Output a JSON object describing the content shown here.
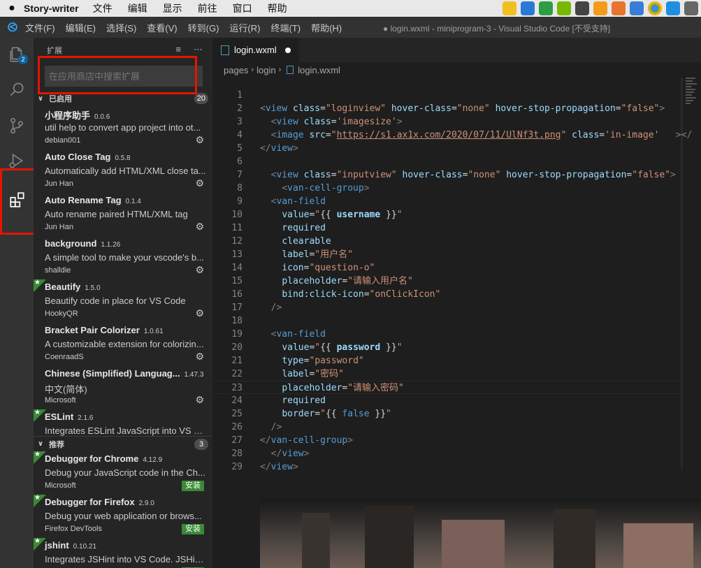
{
  "macbar": {
    "app_name": "Story-writer",
    "menus": [
      "文件",
      "编辑",
      "显示",
      "前往",
      "窗口",
      "帮助"
    ],
    "tray_icons": [
      "qq-icon",
      "notes-icon",
      "shield-icon",
      "nvidia-icon",
      "share-icon",
      "flame-icon",
      "calendar-icon",
      "security-icon",
      "chrome-icon",
      "ie-icon",
      "monitor-icon"
    ]
  },
  "titlebar": {
    "menus": [
      "文件(F)",
      "编辑(E)",
      "选择(S)",
      "查看(V)",
      "转到(G)",
      "运行(R)",
      "终端(T)",
      "帮助(H)"
    ],
    "window_title": "● login.wxml - miniprogram-3 - Visual Studio Code [不受支持]"
  },
  "activity": {
    "explorer_badge": "2",
    "items": [
      "explorer",
      "search",
      "source-control",
      "run-debug",
      "extensions"
    ],
    "active": "extensions"
  },
  "sidebar": {
    "title": "扩展",
    "search_placeholder": "在应用商店中搜索扩展",
    "installed_header": "已启用",
    "installed_count": "20",
    "installed": [
      {
        "name": "小程序助手",
        "version": "0.0.6",
        "desc": "util help to convert app project into ot...",
        "publisher": "debian001",
        "starred": false
      },
      {
        "name": "Auto Close Tag",
        "version": "0.5.8",
        "desc": "Automatically add HTML/XML close ta...",
        "publisher": "Jun Han",
        "starred": false
      },
      {
        "name": "Auto Rename Tag",
        "version": "0.1.4",
        "desc": "Auto rename paired HTML/XML tag",
        "publisher": "Jun Han",
        "starred": false
      },
      {
        "name": "background",
        "version": "1.1.26",
        "desc": "A simple tool to make your vscode's b...",
        "publisher": "shalldie",
        "starred": false
      },
      {
        "name": "Beautify",
        "version": "1.5.0",
        "desc": "Beautify code in place for VS Code",
        "publisher": "HookyQR",
        "starred": true
      },
      {
        "name": "Bracket Pair Colorizer",
        "version": "1.0.61",
        "desc": "A customizable extension for colorizin...",
        "publisher": "CoenraadS",
        "starred": false
      },
      {
        "name": "Chinese (Simplified) Languag...",
        "version": "1.47.3",
        "desc": "中文(简体)",
        "publisher": "Microsoft",
        "starred": false
      },
      {
        "name": "ESLint",
        "version": "2.1.6",
        "desc": "Integrates ESLint JavaScript into VS C...",
        "publisher": "",
        "starred": true
      }
    ],
    "recommended_header": "推荐",
    "recommended_count": "3",
    "install_label": "安装",
    "recommended": [
      {
        "name": "Debugger for Chrome",
        "version": "4.12.9",
        "desc": "Debug your JavaScript code in the Ch...",
        "publisher": "Microsoft",
        "starred": true
      },
      {
        "name": "Debugger for Firefox",
        "version": "2.9.0",
        "desc": "Debug your web application or brows...",
        "publisher": "Firefox DevTools",
        "starred": true
      },
      {
        "name": "jshint",
        "version": "0.10.21",
        "desc": "Integrates JSHint into VS Code. JSHint...",
        "publisher": "",
        "starred": true
      }
    ]
  },
  "editor": {
    "tab_label": "login.wxml",
    "breadcrumb": [
      "pages",
      "login",
      "login.wxml"
    ],
    "lines": [
      {
        "n": "1",
        "html": ""
      },
      {
        "n": "2",
        "html": "<span class='brk'>&lt;</span><span class='tag'>view</span> <span class='attr'>class</span>=<span class='str'>\"loginview\"</span> <span class='attr'>hover-class</span>=<span class='str'>\"none\"</span> <span class='attr'>hover-stop-propagation</span>=<span class='str'>\"false\"</span><span class='brk'>&gt;</span>"
      },
      {
        "n": "3",
        "html": "  <span class='brk'>&lt;</span><span class='tag'>view</span> <span class='attr'>class</span>=<span class='str'>'imagesize'</span><span class='brk'>&gt;</span>"
      },
      {
        "n": "4",
        "html": "  <span class='brk'>&lt;</span><span class='tag'>image</span> <span class='attr'>src</span>=<span class='str'>\"<u>https://s1.ax1x.com/2020/07/11/UlNf3t.png</u>\"</span> <span class='attr'>class</span>=<span class='str'>'in-image'</span>   <span class='brk'>&gt;&lt;/</span>"
      },
      {
        "n": "5",
        "html": "<span class='brk'>&lt;/</span><span class='tag'>view</span><span class='brk'>&gt;</span>"
      },
      {
        "n": "6",
        "html": ""
      },
      {
        "n": "7",
        "html": "  <span class='brk'>&lt;</span><span class='tag'>view</span> <span class='attr'>class</span>=<span class='str'>\"inputview\"</span> <span class='attr'>hover-class</span>=<span class='str'>\"none\"</span> <span class='attr'>hover-stop-propagation</span>=<span class='str'>\"false\"</span><span class='brk'>&gt;</span>"
      },
      {
        "n": "8",
        "html": "    <span class='brk'>&lt;</span><span class='tag'>van-cell-group</span><span class='brk'>&gt;</span>"
      },
      {
        "n": "9",
        "html": "  <span class='brk'>&lt;</span><span class='tag'>van-field</span>"
      },
      {
        "n": "10",
        "html": "    <span class='attr'>value</span>=<span class='str'>\"</span><span class='punc'>{{ </span><span class='attr' style='font-weight:bold'>username</span><span class='punc'> }}</span><span class='str'>\"</span>"
      },
      {
        "n": "11",
        "html": "    <span class='attr'>required</span>"
      },
      {
        "n": "12",
        "html": "    <span class='attr'>clearable</span>"
      },
      {
        "n": "13",
        "html": "    <span class='attr'>label</span>=<span class='str'>\"用户名\"</span>"
      },
      {
        "n": "14",
        "html": "    <span class='attr'>icon</span>=<span class='str'>\"question-o\"</span>"
      },
      {
        "n": "15",
        "html": "    <span class='attr'>placeholder</span>=<span class='str'>\"请输入用户名\"</span>"
      },
      {
        "n": "16",
        "html": "    <span class='attr'>bind:click-icon</span>=<span class='str'>\"onClickIcon\"</span>"
      },
      {
        "n": "17",
        "html": "  <span class='brk'>/&gt;</span>"
      },
      {
        "n": "18",
        "html": ""
      },
      {
        "n": "19",
        "html": "  <span class='brk'>&lt;</span><span class='tag'>van-field</span>"
      },
      {
        "n": "20",
        "html": "    <span class='attr'>value</span>=<span class='str'>\"</span><span class='punc'>{{ </span><span class='attr' style='font-weight:bold'>password</span><span class='punc'> }}</span><span class='str'>\"</span>"
      },
      {
        "n": "21",
        "html": "    <span class='attr'>type</span>=<span class='str'>\"password\"</span>"
      },
      {
        "n": "22",
        "html": "    <span class='attr'>label</span>=<span class='str'>\"密码\"</span>"
      },
      {
        "n": "23",
        "html": "    <span class='attr'>placeholder</span>=<span class='str'>\"请输入密码\"</span>"
      },
      {
        "n": "24",
        "html": "    <span class='attr'>required</span>"
      },
      {
        "n": "25",
        "html": "    <span class='attr'>border</span>=<span class='str'>\"</span><span class='punc'>{{ </span><span class='tag'>false</span><span class='punc'> }}</span><span class='str'>\"</span>"
      },
      {
        "n": "26",
        "html": "  <span class='brk'>/&gt;</span>"
      },
      {
        "n": "27",
        "html": "<span class='brk'>&lt;/</span><span class='tag'>van-cell-group</span><span class='brk'>&gt;</span>"
      },
      {
        "n": "28",
        "html": "  <span class='brk'>&lt;/</span><span class='tag'>view</span><span class='brk'>&gt;</span>"
      },
      {
        "n": "29",
        "html": "<span class='brk'>&lt;/</span><span class='tag'>view</span><span class='brk'>&gt;</span>"
      }
    ]
  }
}
